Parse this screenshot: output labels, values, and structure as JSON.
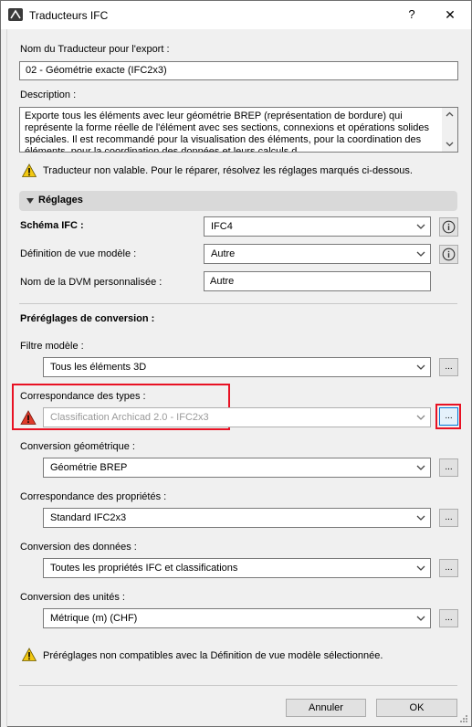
{
  "window": {
    "title": "Traducteurs IFC",
    "help_label": "?",
    "close_label": "✕"
  },
  "export": {
    "name_label": "Nom du Traducteur pour l'export :",
    "name_value": "02 - Géométrie exacte (IFC2x3)",
    "description_label": "Description :",
    "description_value": "Exporte tous les éléments avec leur géométrie BREP (représentation de bordure) qui représente la forme réelle de l'élément avec ses sections, connexions et opérations solides spéciales. Il est recommandé pour la visualisation des éléments, pour la coordination des éléments, pour la coordination des données et leurs calculs d..."
  },
  "warning_top": "Traducteur non valable. Pour le réparer, résolvez les réglages marqués ci-dessous.",
  "settings": {
    "header": "Réglages",
    "schema_label": "Schéma IFC :",
    "schema_value": "IFC4",
    "mvd_label": "Définition de vue modèle :",
    "mvd_value": "Autre",
    "custom_mvd_label": "Nom de la DVM personnalisée :",
    "custom_mvd_value": "Autre"
  },
  "presets": {
    "header": "Préréglages de conversion :",
    "model_filter_label": "Filtre modèle :",
    "model_filter_value": "Tous les éléments 3D",
    "type_mapping_label": "Correspondance des types :",
    "type_mapping_value": "Classification Archicad 2.0 - IFC2x3",
    "geometry_label": "Conversion géométrique :",
    "geometry_value": "Géométrie BREP",
    "property_label": "Correspondance des propriétés :",
    "property_value": "Standard IFC2x3",
    "data_label": "Conversion des données :",
    "data_value": "Toutes les propriétés IFC et classifications",
    "units_label": "Conversion des unités :",
    "units_value": "Métrique (m) (CHF)",
    "dots_label": "..."
  },
  "warning_bottom": "Préréglages non compatibles avec la Définition de vue modèle sélectionnée.",
  "buttons": {
    "cancel": "Annuler",
    "ok": "OK"
  }
}
